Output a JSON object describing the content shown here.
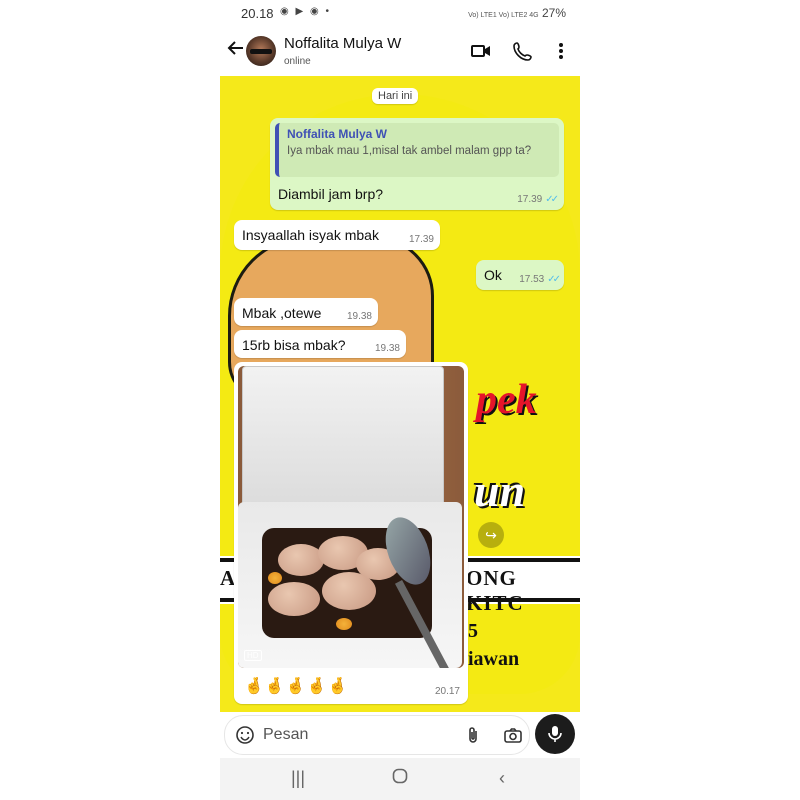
{
  "status_bar": {
    "time": "20.18",
    "app_icons": "◉ ▶ ◉ •",
    "signal_text": "Vo) LTE1 Vo) LTE2 4G",
    "battery": "27%"
  },
  "header": {
    "contact_name": "Noffalita Mulya W",
    "contact_status": "online"
  },
  "chat": {
    "date_chip": "Hari ini",
    "messages": [
      {
        "type": "out",
        "quote_name": "Noffalita Mulya W",
        "quote_text": "Iya mbak mau 1,misal tak ambel malam gpp ta?",
        "text": "Diambil jam brp?",
        "time": "17.39",
        "ticks": "✓✓"
      },
      {
        "type": "in",
        "text": "Insyaallah isyak mbak",
        "time": "17.39"
      },
      {
        "type": "out",
        "text": "Ok",
        "time": "17.53",
        "ticks": "✓✓"
      },
      {
        "type": "in",
        "text": "Mbak ,otewe",
        "time": "19.38"
      },
      {
        "type": "in",
        "text": "15rb bisa mbak?",
        "time": "19.38"
      }
    ],
    "image_message": {
      "hd_label": "HD",
      "caption": "🤞🤞🤞🤞🤞",
      "time": "20.17"
    }
  },
  "wallpaper": {
    "text_pek": "pek",
    "text_un": "un",
    "banner_left": "A",
    "banner_right": "ONG KITC",
    "line_five": "5",
    "line_iawan": "iawan"
  },
  "input": {
    "placeholder": "Pesan"
  },
  "colors": {
    "outgoing_bubble": "#dcf7c5",
    "incoming_bubble": "#ffffff",
    "wallpaper_yellow": "#f4ea13",
    "read_tick": "#53bdeb",
    "quote_accent": "#3f51b5",
    "mic_button": "#1c1c1c"
  },
  "icons": [
    "back-arrow-icon",
    "video-call-icon",
    "phone-icon",
    "more-vert-icon",
    "emoji-sticker-icon",
    "attach-icon",
    "camera-icon",
    "mic-icon",
    "forward-icon",
    "recents-nav-icon",
    "home-nav-icon",
    "back-nav-icon"
  ]
}
